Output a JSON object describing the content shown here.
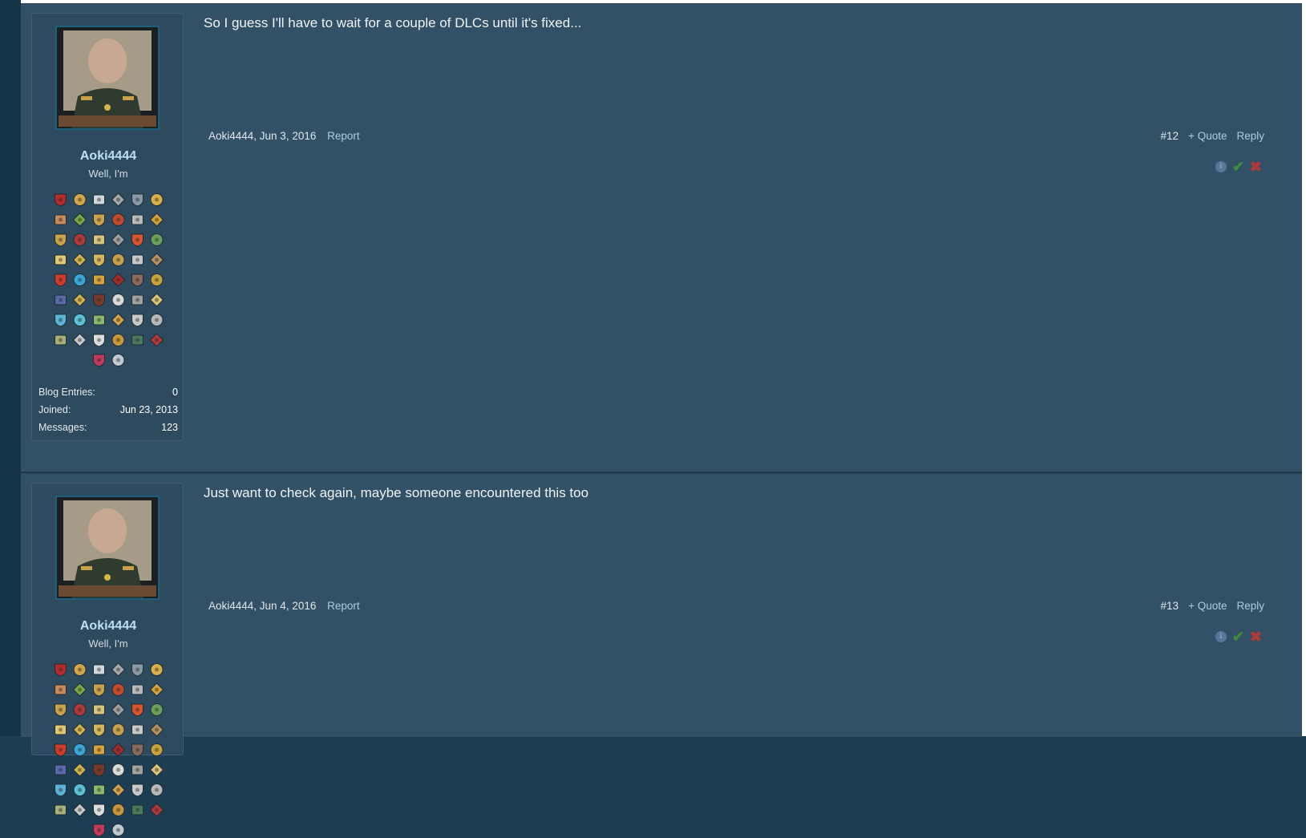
{
  "posts": [
    {
      "username": "Aoki4444",
      "user_title": "Well, I'm",
      "stats": [
        {
          "label": "Blog Entries:",
          "value": "0"
        },
        {
          "label": "Joined:",
          "value": "Jun 23, 2013"
        },
        {
          "label": "Messages:",
          "value": "123"
        }
      ],
      "message": "So I guess I'll have to wait for a couple of DLCs until it's fixed...",
      "author_date": "Aoki4444, Jun 3, 2016",
      "report_label": "Report",
      "post_number": "#12",
      "quote_label": "+ Quote",
      "reply_label": "Reply"
    },
    {
      "username": "Aoki4444",
      "user_title": "Well, I'm",
      "message": "Just want to check again, maybe someone encountered this too",
      "author_date": "Aoki4444, Jun 4, 2016",
      "report_label": "Report",
      "post_number": "#13",
      "quote_label": "+ Quote",
      "reply_label": "Reply"
    }
  ],
  "trophy_colors": [
    "#b52a2a",
    "#d2a64a",
    "#cfd7dc",
    "#a8a8a8",
    "#8a98a5",
    "#d8b04a",
    "#c98a5a",
    "#7aa84a",
    "#c9a24a",
    "#c24a2a",
    "#b8b8b8",
    "#d2a13a",
    "#c9a24a",
    "#b03a3a",
    "#d7c37a",
    "#a0a0a0",
    "#d9542a",
    "#6aa05a",
    "#e0c870",
    "#d3b24a",
    "#d6b65a",
    "#c8a24a",
    "#c8c8c8",
    "#b89060",
    "#d23a2a",
    "#3aa6d8",
    "#d6a23a",
    "#a52a2a",
    "#8a6a5a",
    "#c7a23a",
    "#5a6aa8",
    "#d1b14a",
    "#7a3a2a",
    "#d9d9d9",
    "#a0a0a0",
    "#d7c37a",
    "#5ab4d6",
    "#5ac0d6",
    "#8ab86a",
    "#d3a24a",
    "#c8c8c8",
    "#b8b8b8",
    "#a8b07a",
    "#c8c8c8",
    "#dcdcdc",
    "#c8963a",
    "#4a7a5a",
    "#b03a3a",
    "#c23a5a",
    "#c0c8d0"
  ],
  "colors": {
    "background": "#325166",
    "link": "#a8cde3",
    "username": "#bfe0f2"
  }
}
